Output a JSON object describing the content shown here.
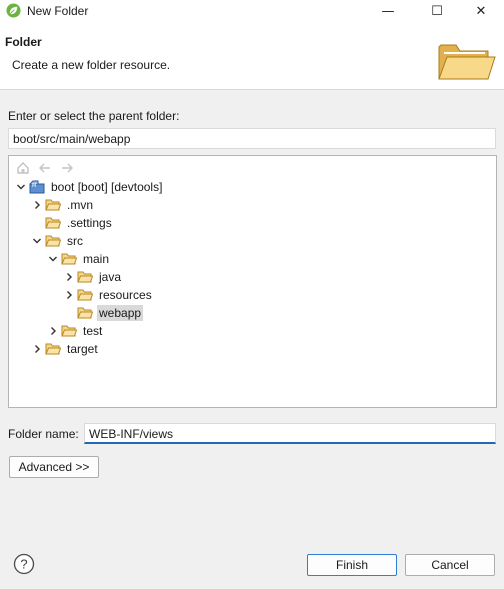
{
  "window": {
    "title": "New Folder",
    "app_icon": "spring-leaf-icon",
    "controls": {
      "minimize": "—",
      "maximize": "☐",
      "close": "✕"
    }
  },
  "banner": {
    "heading": "Folder",
    "description": "Create a new folder resource.",
    "art_icon": "open-folder-icon"
  },
  "parent": {
    "label": "Enter or select the parent folder:",
    "value": "boot/src/main/webapp"
  },
  "tree": {
    "toolbar": [
      "home-icon",
      "back-arrow-icon",
      "forward-arrow-icon"
    ],
    "items": [
      {
        "label": "boot [boot] [devtools]",
        "level": 0,
        "state": "expanded",
        "icon": "maven-project-icon"
      },
      {
        "label": ".mvn",
        "level": 1,
        "state": "collapsed",
        "icon": "folder-icon"
      },
      {
        "label": ".settings",
        "level": 1,
        "state": "none",
        "icon": "folder-icon"
      },
      {
        "label": "src",
        "level": 1,
        "state": "expanded",
        "icon": "folder-icon"
      },
      {
        "label": "main",
        "level": 2,
        "state": "expanded",
        "icon": "folder-icon"
      },
      {
        "label": "java",
        "level": 3,
        "state": "collapsed",
        "icon": "folder-icon"
      },
      {
        "label": "resources",
        "level": 3,
        "state": "collapsed",
        "icon": "folder-icon"
      },
      {
        "label": "webapp",
        "level": 3,
        "state": "none",
        "icon": "folder-icon",
        "selected": true
      },
      {
        "label": "test",
        "level": 2,
        "state": "collapsed",
        "icon": "folder-icon"
      },
      {
        "label": "target",
        "level": 1,
        "state": "collapsed",
        "icon": "folder-icon"
      }
    ]
  },
  "folder_name": {
    "label": "Folder name:",
    "value": "WEB-INF/views"
  },
  "buttons": {
    "advanced": "Advanced >>",
    "finish": "Finish",
    "cancel": "Cancel",
    "help": "help-icon"
  },
  "colors": {
    "accent": "#2469b8",
    "folder": "#e8b54a",
    "selection": "#d9d9d9"
  }
}
